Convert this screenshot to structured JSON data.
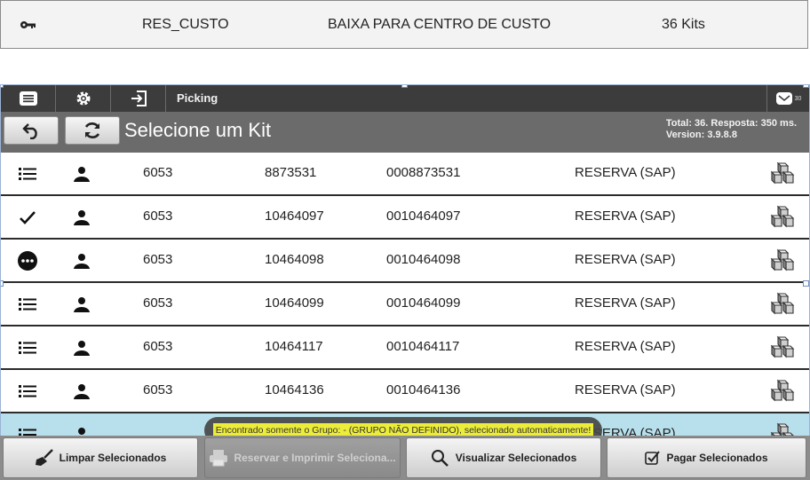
{
  "top_row": {
    "code": "RES_CUSTO",
    "description": "BAIXA PARA CENTRO DE CUSTO",
    "quantity": "36 Kits"
  },
  "toolbar": {
    "title": "Picking",
    "icons": [
      "menu-icon",
      "gear-icon",
      "login-icon"
    ],
    "right_badge": "30"
  },
  "header": {
    "title": "Selecione um Kit",
    "info_line1": "Total: 36. Resposta: 350 ms.",
    "info_line2": "Version: 3.9.8.8"
  },
  "rows": [
    {
      "status_icon": "list-icon",
      "plant": "6053",
      "number": "8873531",
      "padded": "0008873531",
      "type": "RESERVA (SAP)"
    },
    {
      "status_icon": "check-icon",
      "plant": "6053",
      "number": "10464097",
      "padded": "0010464097",
      "type": "RESERVA (SAP)"
    },
    {
      "status_icon": "more-icon",
      "plant": "6053",
      "number": "10464098",
      "padded": "0010464098",
      "type": "RESERVA (SAP)"
    },
    {
      "status_icon": "list-icon",
      "plant": "6053",
      "number": "10464099",
      "padded": "0010464099",
      "type": "RESERVA (SAP)"
    },
    {
      "status_icon": "list-icon",
      "plant": "6053",
      "number": "10464117",
      "padded": "0010464117",
      "type": "RESERVA (SAP)"
    },
    {
      "status_icon": "list-icon",
      "plant": "6053",
      "number": "10464136",
      "padded": "0010464136",
      "type": "RESERVA (SAP)"
    },
    {
      "status_icon": "list-icon",
      "plant": "",
      "number": "",
      "padded": "",
      "type": "RESERVA (SAP)"
    }
  ],
  "toast": "Encontrado somente o Grupo: - (GRUPO NÃO DEFINIDO), selecionado automaticamente!",
  "buttons": {
    "clear": "Limpar Selecionados",
    "reserve_print": "Reservar e Imprimir Seleciona...",
    "view": "Visualizar Selecionados",
    "pay": "Pagar Selecionados"
  },
  "colors": {
    "toolbar_bg": "#3c3c3c",
    "header_bg": "#6b6b6b",
    "selected_row": "#b8e0ec",
    "toast_highlight": "#ecec3a"
  }
}
